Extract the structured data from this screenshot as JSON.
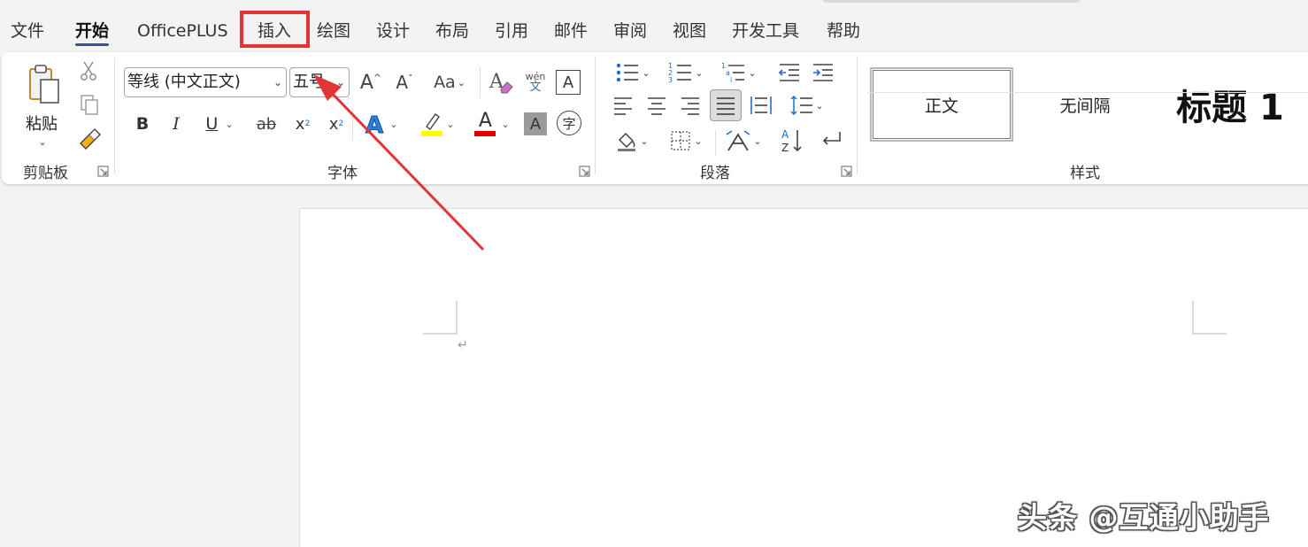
{
  "tabs": [
    {
      "label": "文件",
      "active": false
    },
    {
      "label": "开始",
      "active": true
    },
    {
      "label": "OfficePLUS",
      "active": false
    },
    {
      "label": "插入",
      "active": false
    },
    {
      "label": "绘图",
      "active": false
    },
    {
      "label": "设计",
      "active": false
    },
    {
      "label": "布局",
      "active": false
    },
    {
      "label": "引用",
      "active": false
    },
    {
      "label": "邮件",
      "active": false
    },
    {
      "label": "审阅",
      "active": false
    },
    {
      "label": "视图",
      "active": false
    },
    {
      "label": "开发工具",
      "active": false
    },
    {
      "label": "帮助",
      "active": false
    }
  ],
  "clipboard": {
    "paste_label": "粘贴",
    "group_label": "剪贴板"
  },
  "font": {
    "font_name": "等线 (中文正文)",
    "font_size": "五号",
    "change_case_label": "Aa",
    "phonetic_top": "wén",
    "phonetic_bottom": "文",
    "bold": "B",
    "italic": "I",
    "underline": "U",
    "strike": "ab",
    "subscript": "x",
    "superscript": "x",
    "font_color_letter": "A",
    "shading_letter": "A",
    "enclose_char": "字",
    "group_label": "字体",
    "highlight_color": "#ffff00",
    "font_color": "#e00000"
  },
  "paragraph": {
    "group_label": "段落"
  },
  "styles": {
    "items": [
      "正文",
      "无间隔",
      "标题 1"
    ],
    "group_label": "样式"
  },
  "document": {
    "paragraph_mark": "↵"
  },
  "watermark": "头条 @互通小助手",
  "colors": {
    "annotation_red": "#e33436",
    "accent_blue": "#2b579a",
    "icon_blue": "#1e6fc9"
  }
}
